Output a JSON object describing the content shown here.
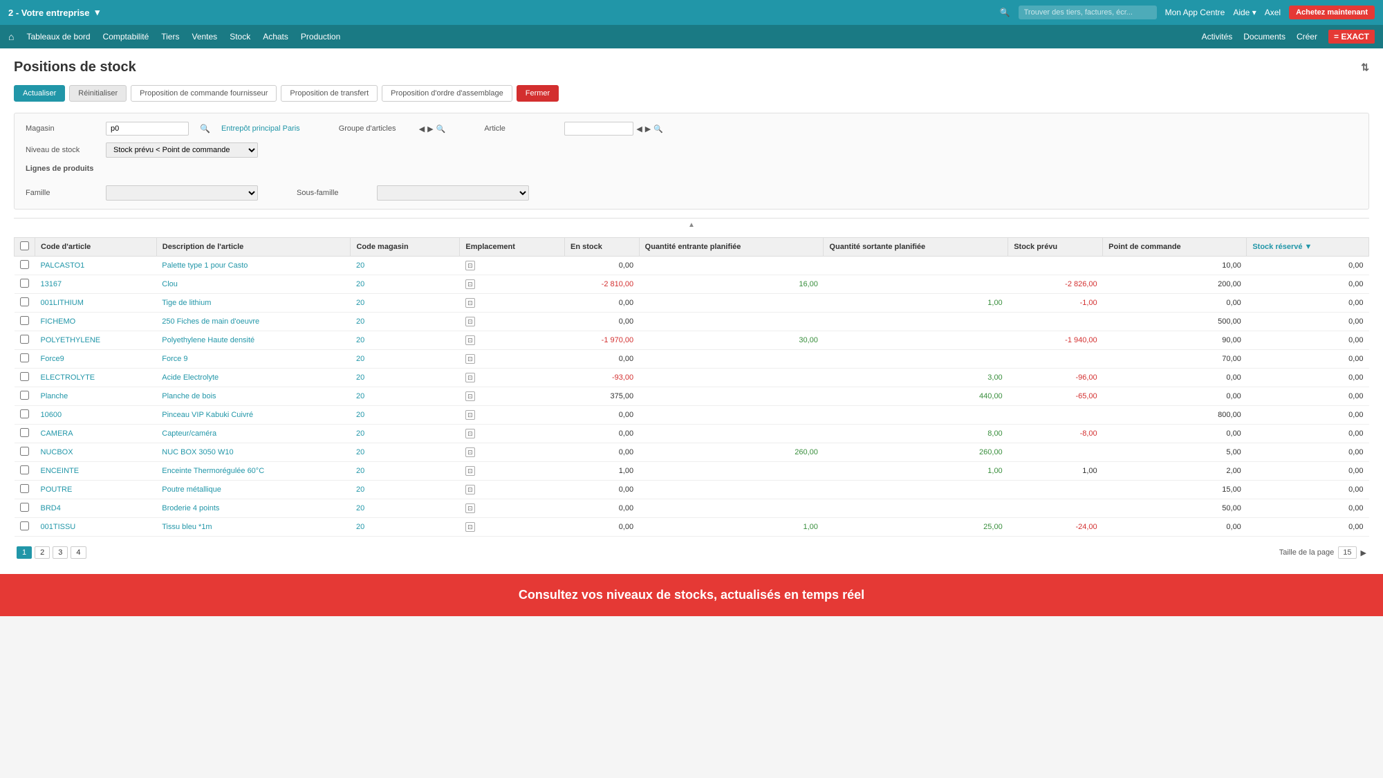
{
  "company": {
    "name": "2 - Votre entreprise",
    "chevron": "▾"
  },
  "topbar": {
    "search_placeholder": "Trouver des tiers, factures, écr...",
    "app_centre": "Mon App Centre",
    "aide": "Aide",
    "aide_chevron": "▾",
    "user": "Axel",
    "cta": "Achetez maintenant"
  },
  "mainnav": {
    "home_icon": "⌂",
    "items": [
      "Tableaux de bord",
      "Comptabilité",
      "Tiers",
      "Ventes",
      "Stock",
      "Achats",
      "Production"
    ],
    "right": [
      "Activités",
      "Documents",
      "Créer"
    ],
    "logo": "= EXACT"
  },
  "page": {
    "title": "Positions de stock",
    "sort_icon": "⇅"
  },
  "toolbar": {
    "actualiser": "Actualiser",
    "reinitialiser": "Réinitialiser",
    "proposition_commande": "Proposition de commande fournisseur",
    "proposition_transfert": "Proposition de transfert",
    "proposition_ordre": "Proposition d'ordre d'assemblage",
    "fermer": "Fermer"
  },
  "filters": {
    "magasin_label": "Magasin",
    "magasin_value": "p0",
    "magasin_link": "Entrepôt principal Paris",
    "groupe_label": "Groupe d'articles",
    "article_label": "Article",
    "niveau_label": "Niveau de stock",
    "niveau_value": "Stock prévu < Point de commande",
    "lignes_label": "Lignes de produits",
    "famille_label": "Famille",
    "sous_famille_label": "Sous-famille",
    "collapse": "▲"
  },
  "table": {
    "columns": [
      "Code d'article",
      "Description de l'article",
      "Code magasin",
      "Emplacement",
      "En stock",
      "Quantité entrante planifiée",
      "Quantité sortante planifiée",
      "Stock prévu",
      "Point de commande",
      "Stock réservé"
    ],
    "rows": [
      {
        "code": "PALCASTO1",
        "description": "Palette type 1 pour Casto",
        "magasin": "20",
        "en_stock": "0,00",
        "qte_entrante": "",
        "qte_sortante": "",
        "stock_prevu": "",
        "point_commande": "10,00",
        "stock_reserve": "0,00"
      },
      {
        "code": "13167",
        "description": "Clou",
        "magasin": "20",
        "en_stock": "-2 810,00",
        "qte_entrante": "16,00",
        "qte_sortante": "",
        "stock_prevu": "-2 826,00",
        "point_commande": "200,00",
        "stock_reserve": "0,00"
      },
      {
        "code": "001LITHIUM",
        "description": "Tige de lithium",
        "magasin": "20",
        "en_stock": "0,00",
        "qte_entrante": "",
        "qte_sortante": "1,00",
        "stock_prevu": "-1,00",
        "point_commande": "0,00",
        "stock_reserve": "0,00"
      },
      {
        "code": "FICHEMO",
        "description": "250 Fiches de main d'oeuvre",
        "magasin": "20",
        "en_stock": "0,00",
        "qte_entrante": "",
        "qte_sortante": "",
        "stock_prevu": "",
        "point_commande": "500,00",
        "stock_reserve": "0,00"
      },
      {
        "code": "POLYETHYLENE",
        "description": "Polyethylene Haute densité",
        "magasin": "20",
        "en_stock": "-1 970,00",
        "qte_entrante": "30,00",
        "qte_sortante": "",
        "stock_prevu": "-1 940,00",
        "point_commande": "90,00",
        "stock_reserve": "0,00"
      },
      {
        "code": "Force9",
        "description": "Force 9",
        "magasin": "20",
        "en_stock": "0,00",
        "qte_entrante": "",
        "qte_sortante": "",
        "stock_prevu": "",
        "point_commande": "70,00",
        "stock_reserve": "0,00"
      },
      {
        "code": "ELECTROLYTE",
        "description": "Acide Electrolyte",
        "magasin": "20",
        "en_stock": "-93,00",
        "qte_entrante": "",
        "qte_sortante": "3,00",
        "stock_prevu": "-96,00",
        "point_commande": "0,00",
        "stock_reserve": "0,00"
      },
      {
        "code": "Planche",
        "description": "Planche de bois",
        "magasin": "20",
        "en_stock": "375,00",
        "qte_entrante": "",
        "qte_sortante": "440,00",
        "stock_prevu": "-65,00",
        "point_commande": "0,00",
        "stock_reserve": "0,00"
      },
      {
        "code": "10600",
        "description": "Pinceau VIP Kabuki Cuivré",
        "magasin": "20",
        "en_stock": "0,00",
        "qte_entrante": "",
        "qte_sortante": "",
        "stock_prevu": "",
        "point_commande": "800,00",
        "stock_reserve": "0,00"
      },
      {
        "code": "CAMERA",
        "description": "Capteur/caméra",
        "magasin": "20",
        "en_stock": "0,00",
        "qte_entrante": "",
        "qte_sortante": "8,00",
        "stock_prevu": "-8,00",
        "point_commande": "0,00",
        "stock_reserve": "0,00"
      },
      {
        "code": "NUCBOX",
        "description": "NUC BOX 3050 W10",
        "magasin": "20",
        "en_stock": "0,00",
        "qte_entrante": "260,00",
        "qte_sortante": "260,00",
        "stock_prevu": "",
        "point_commande": "5,00",
        "stock_reserve": "0,00"
      },
      {
        "code": "ENCEINTE",
        "description": "Enceinte Thermorégulée 60°C",
        "magasin": "20",
        "en_stock": "1,00",
        "qte_entrante": "",
        "qte_sortante": "1,00",
        "stock_prevu": "1,00",
        "point_commande": "2,00",
        "stock_reserve": "0,00"
      },
      {
        "code": "POUTRE",
        "description": "Poutre métallique",
        "magasin": "20",
        "en_stock": "0,00",
        "qte_entrante": "",
        "qte_sortante": "",
        "stock_prevu": "",
        "point_commande": "15,00",
        "stock_reserve": "0,00"
      },
      {
        "code": "BRD4",
        "description": "Broderie 4 points",
        "magasin": "20",
        "en_stock": "0,00",
        "qte_entrante": "",
        "qte_sortante": "",
        "stock_prevu": "",
        "point_commande": "50,00",
        "stock_reserve": "0,00"
      },
      {
        "code": "001TISSU",
        "description": "Tissu bleu *1m",
        "magasin": "20",
        "en_stock": "0,00",
        "qte_entrante": "1,00",
        "qte_sortante": "25,00",
        "stock_prevu": "-24,00",
        "point_commande": "0,00",
        "stock_reserve": "0,00"
      }
    ]
  },
  "pagination": {
    "pages": [
      "1",
      "2",
      "3",
      "4"
    ],
    "current": "1",
    "taille_label": "Taille de la page",
    "taille_value": "15",
    "next_icon": "▶"
  },
  "footer": {
    "text": "Consultez vos niveaux de stocks, actualisés en temps réel"
  }
}
